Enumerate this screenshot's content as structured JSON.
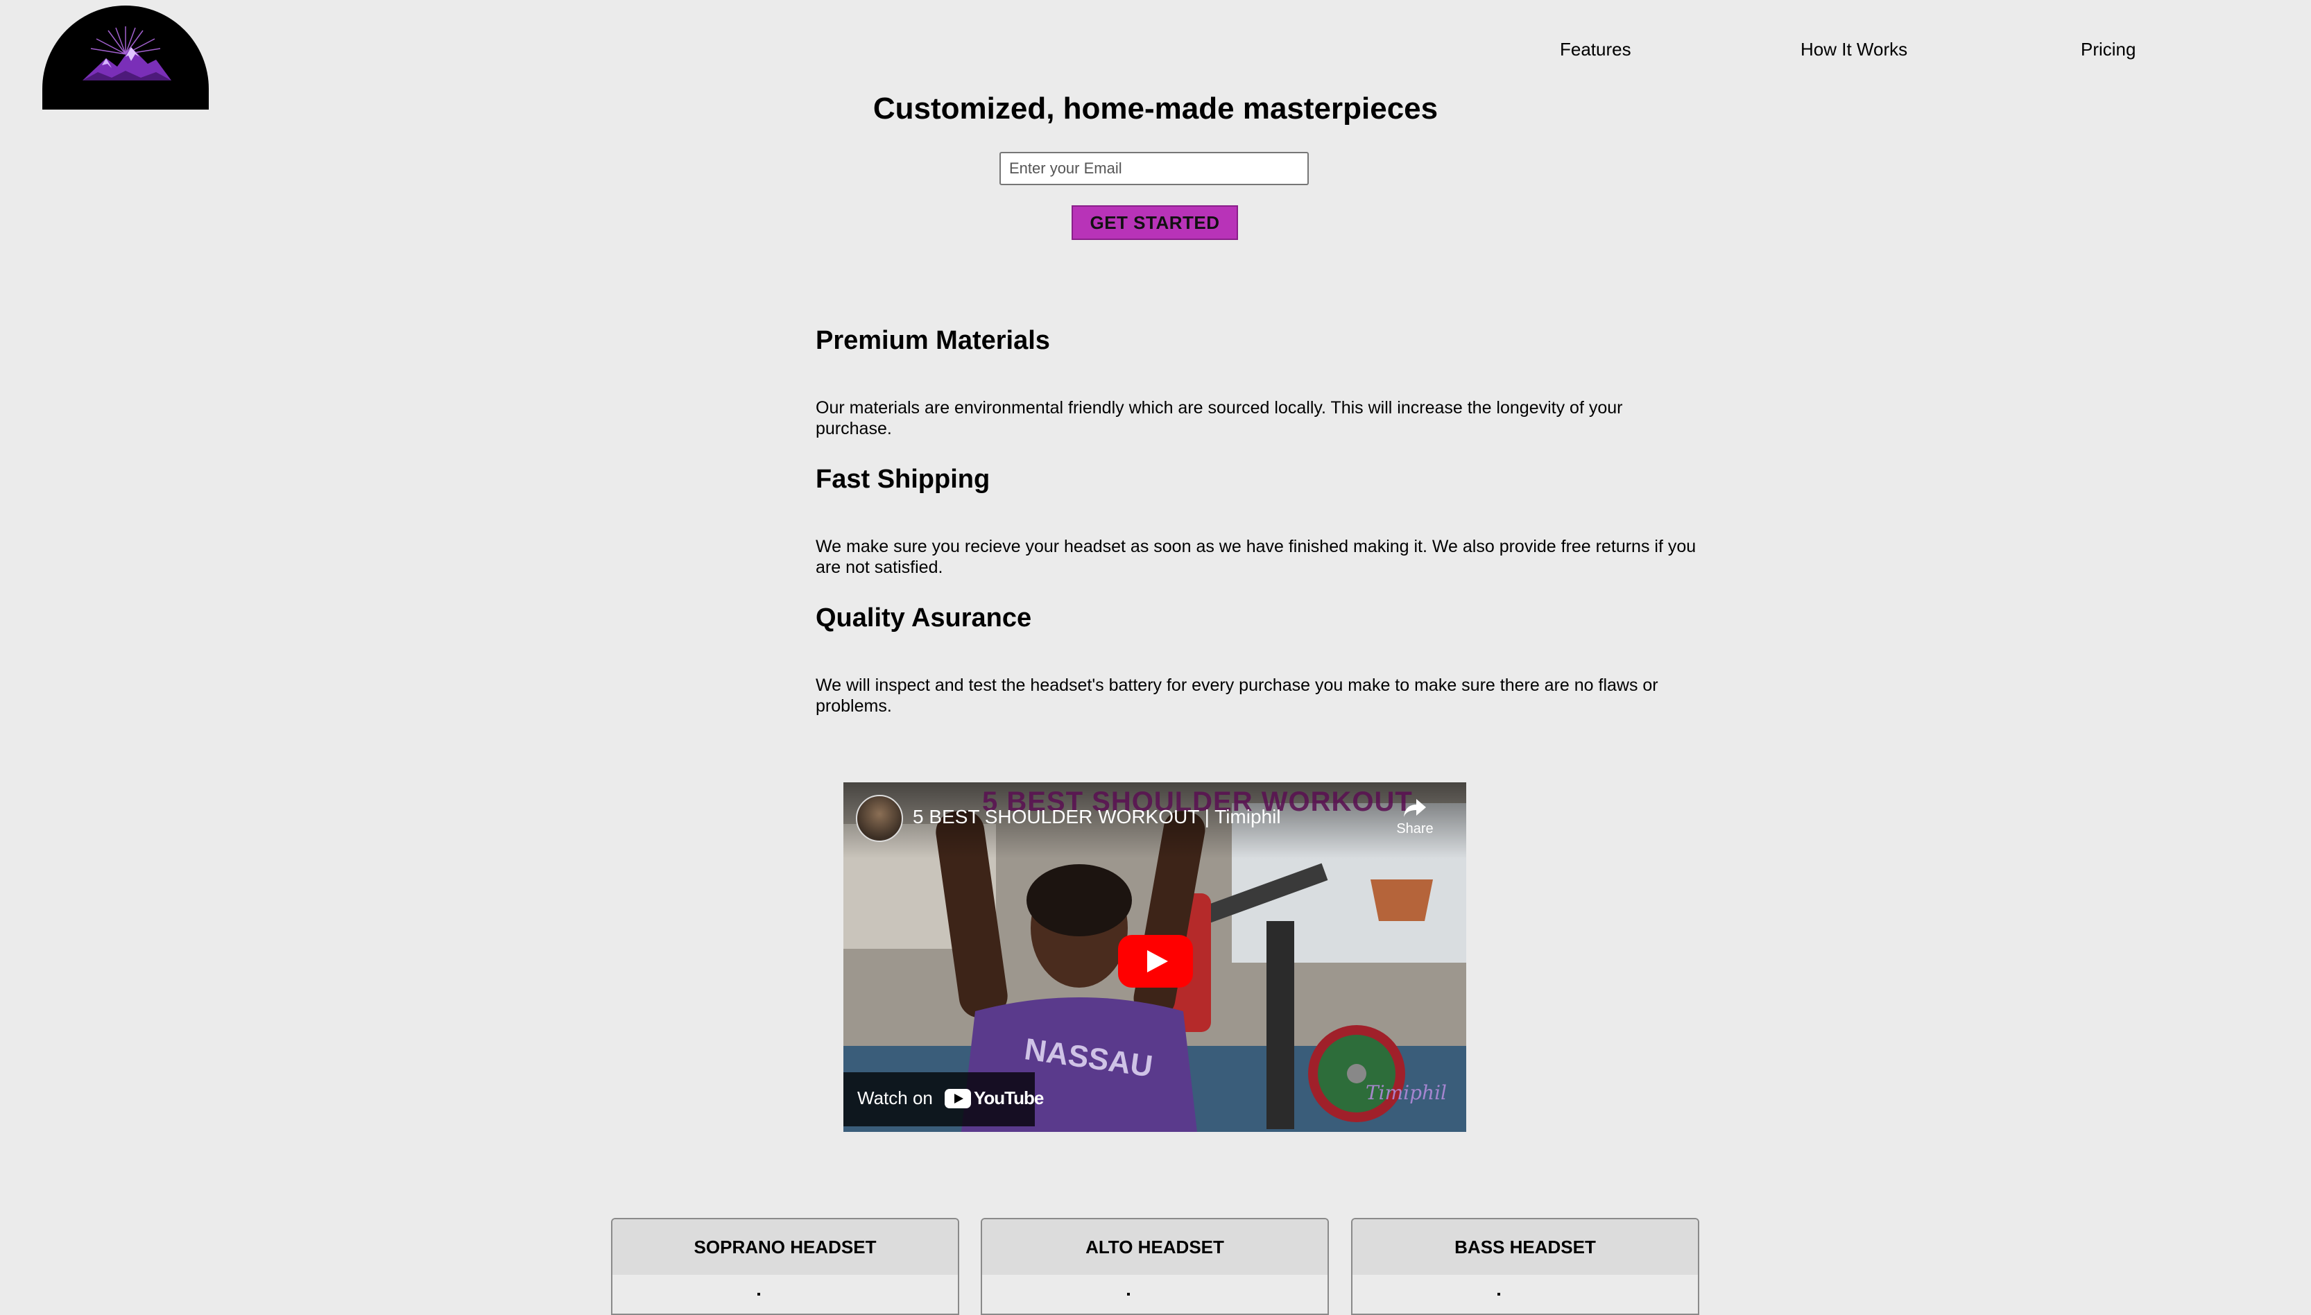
{
  "nav": {
    "items": [
      {
        "label": "Features"
      },
      {
        "label": "How It Works"
      },
      {
        "label": "Pricing"
      }
    ]
  },
  "hero": {
    "title": "Customized, home-made masterpieces",
    "email_placeholder": "Enter your Email",
    "cta_label": "GET STARTED"
  },
  "features": [
    {
      "title": "Premium Materials",
      "text": "Our materials are environmental friendly which are sourced locally. This will increase the longevity of your purchase."
    },
    {
      "title": "Fast Shipping",
      "text": "We make sure you recieve your headset as soon as we have finished making it. We also provide free returns if you are not satisfied."
    },
    {
      "title": "Quality Asurance",
      "text": "We will inspect and test the headset's battery for every purchase you make to make sure there are no flaws or problems."
    }
  ],
  "video": {
    "title": "5 BEST SHOULDER WORKOUT | Timiphil",
    "overlay_title": "5 BEST SHOULDER WORKOUT",
    "share_label": "Share",
    "watch_on_label": "Watch on",
    "youtube_label": "YouTube",
    "watermark": "Timiphil",
    "shirt_text": "NASSAU"
  },
  "pricing": {
    "cards": [
      {
        "title": "SOPRANO HEADSET"
      },
      {
        "title": "ALTO HEADSET"
      },
      {
        "title": "BASS HEADSET"
      }
    ]
  },
  "colors": {
    "background": "#ebebeb",
    "cta": "#b833b8",
    "logo_bg": "#000000",
    "logo_accent": "#a855f7",
    "youtube_red": "#ff0000"
  }
}
